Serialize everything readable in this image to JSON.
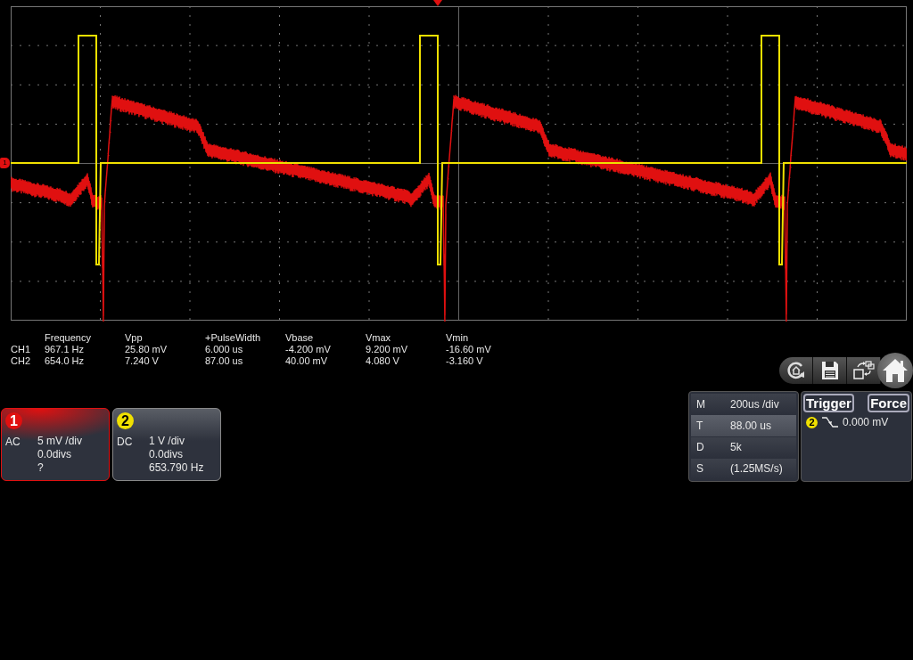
{
  "channel_marker": "1",
  "measurements": {
    "columns": [
      "Frequency",
      "Vpp",
      "+PulseWidth",
      "Vbase",
      "Vmax",
      "Vmin"
    ],
    "rows": [
      {
        "channel": "CH1",
        "values": [
          "967.1 Hz",
          "25.80 mV",
          "6.000 us",
          "-4.200 mV",
          "9.200 mV",
          "-16.60 mV"
        ]
      },
      {
        "channel": "CH2",
        "values": [
          "654.0 Hz",
          "7.240 V",
          "87.00 us",
          "40.00 mV",
          "4.080 V",
          "-3.160 V"
        ]
      }
    ]
  },
  "channels": [
    {
      "number": "1",
      "color": "#e01010",
      "selected": true,
      "coupling": "AC",
      "scale": "5 mV /div",
      "offset": "0.0divs",
      "frequency": "?"
    },
    {
      "number": "2",
      "color": "#f0e000",
      "selected": false,
      "coupling": "DC",
      "scale": "1 V /div",
      "offset": "0.0divs",
      "frequency": "653.790 Hz"
    }
  ],
  "timebase": [
    {
      "key": "M",
      "value": "200us /div",
      "selected": false
    },
    {
      "key": "T",
      "value": "88.00 us",
      "selected": true
    },
    {
      "key": "D",
      "value": "5k",
      "selected": false
    },
    {
      "key": "S",
      "value": "(1.25MS/s)",
      "selected": false
    }
  ],
  "trigger": {
    "title": "Trigger",
    "force": "Force",
    "source": {
      "label": "2",
      "color": "#f0e000"
    },
    "level": "0.000 mV"
  }
}
